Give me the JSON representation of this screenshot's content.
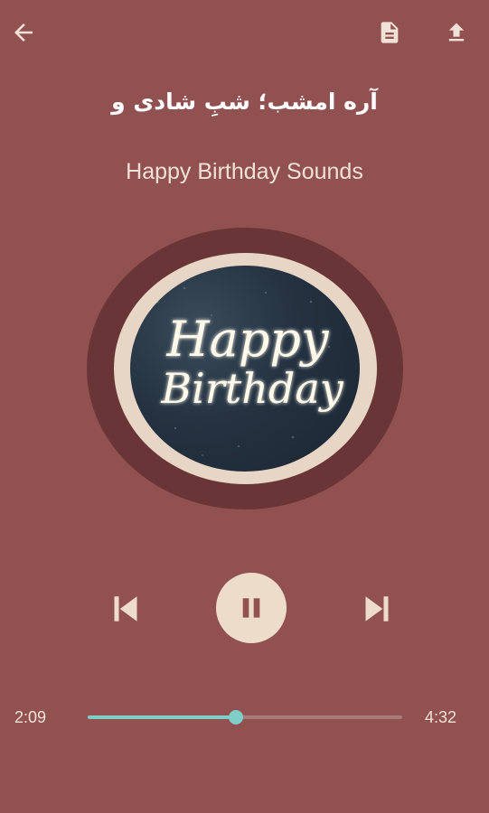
{
  "colors": {
    "background": "#925151",
    "accent": "#7fcfc8",
    "art_outer": "#6a3537",
    "art_ring": "#e7d6c5"
  },
  "header": {
    "back_icon": "arrow-left-icon",
    "lyrics_icon": "document-icon",
    "share_icon": "upload-icon"
  },
  "track": {
    "title": "آره امشب؛ شبِ شادی و",
    "artist": "Happy Birthday Sounds",
    "art_text_line1": "Happy",
    "art_text_line2": "Birthday"
  },
  "controls": {
    "prev_icon": "skip-previous-icon",
    "pause_icon": "pause-icon",
    "next_icon": "skip-next-icon"
  },
  "progress": {
    "elapsed": "2:09",
    "total": "4:32",
    "fraction": 0.47
  }
}
